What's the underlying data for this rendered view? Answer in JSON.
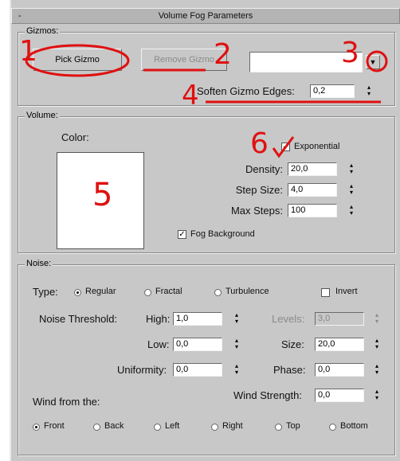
{
  "window": {
    "title": "Volume Fog Parameters",
    "collapse": "-"
  },
  "gizmos": {
    "legend": "Gizmos:",
    "pick_label": "Pick Gizmo",
    "remove_label": "Remove Gizmo",
    "dropdown_value": "",
    "soften_label": "Soften Gizmo Edges:",
    "soften_value": "0,2"
  },
  "volume": {
    "legend": "Volume:",
    "color_label": "Color:",
    "exponential_label": "Exponential",
    "density_label": "Density:",
    "density_value": "20,0",
    "step_label": "Step Size:",
    "step_value": "4,0",
    "maxsteps_label": "Max Steps:",
    "maxsteps_value": "100",
    "fogbg_label": "Fog Background"
  },
  "noise": {
    "legend": "Noise:",
    "type_label": "Type:",
    "regular": "Regular",
    "fractal": "Fractal",
    "turbulence": "Turbulence",
    "invert": "Invert",
    "threshold_label": "Noise Threshold:",
    "high_label": "High:",
    "high_value": "1,0",
    "levels_label": "Levels:",
    "levels_value": "3,0",
    "low_label": "Low:",
    "low_value": "0,0",
    "size_label": "Size:",
    "size_value": "20,0",
    "uniformity_label": "Uniformity:",
    "uniformity_value": "0,0",
    "phase_label": "Phase:",
    "phase_value": "0,0",
    "wind_from_label": "Wind from the:",
    "wind_strength_label": "Wind Strength:",
    "wind_strength_value": "0,0",
    "wind_dirs": [
      "Front",
      "Back",
      "Left",
      "Right",
      "Top",
      "Bottom"
    ]
  },
  "annotations": [
    "1",
    "2",
    "3",
    "4",
    "5",
    "6"
  ],
  "colors": {
    "panel": "#c8c8c8",
    "annotation": "#e01010"
  },
  "icons": {
    "dropdown": "chevron-down-icon",
    "spinner": "spinner-arrows-icon",
    "checkmark": "check-icon"
  }
}
